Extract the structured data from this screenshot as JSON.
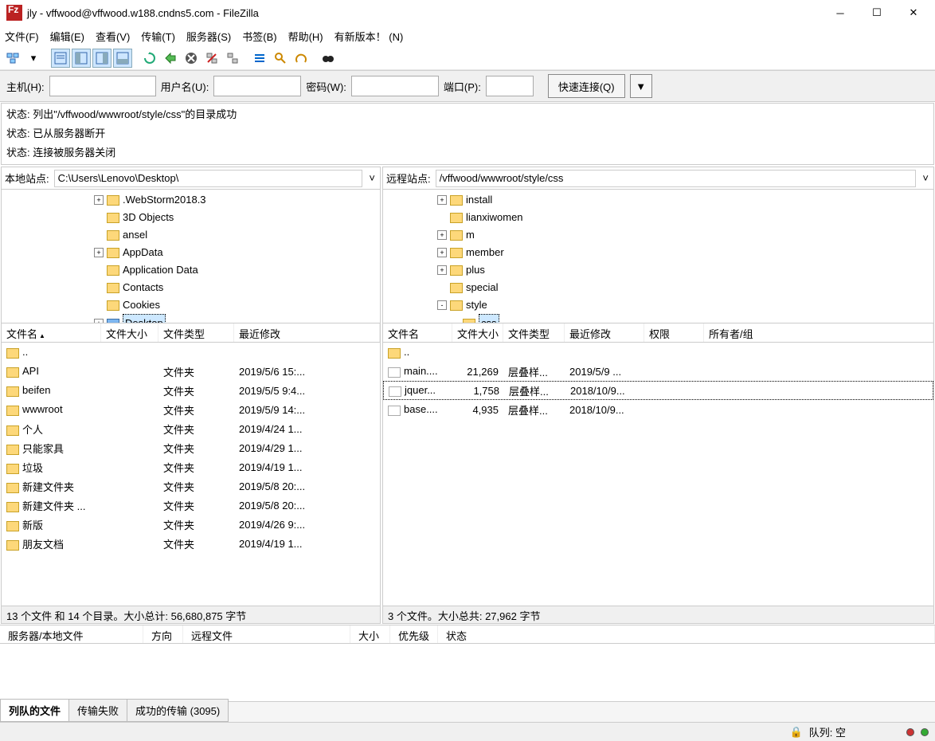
{
  "window": {
    "title": "jly - vffwood@vffwood.w188.cndns5.com - FileZilla"
  },
  "menu": {
    "file": "文件(F)",
    "edit": "编辑(E)",
    "view": "查看(V)",
    "transfer": "传输(T)",
    "server": "服务器(S)",
    "bookmark": "书签(B)",
    "help": "帮助(H)",
    "new_version": "有新版本！ (N)"
  },
  "quick": {
    "host_label": "主机(H):",
    "user_label": "用户名(U):",
    "pass_label": "密码(W):",
    "port_label": "端口(P):",
    "connect": "快速连接(Q)"
  },
  "log": {
    "lines": [
      {
        "k": "状态:",
        "v": "列出\"/vffwood/wwwroot/style/css\"的目录成功"
      },
      {
        "k": "状态:",
        "v": "已从服务器断开"
      },
      {
        "k": "状态:",
        "v": "连接被服务器关闭"
      }
    ]
  },
  "local": {
    "label": "本地站点:",
    "path": "C:\\Users\\Lenovo\\Desktop\\",
    "tree": [
      {
        "indent": 7,
        "exp": "+",
        "label": ".WebStorm2018.3"
      },
      {
        "indent": 7,
        "exp": "",
        "label": "3D Objects"
      },
      {
        "indent": 7,
        "exp": "",
        "label": "ansel"
      },
      {
        "indent": 7,
        "exp": "+",
        "label": "AppData"
      },
      {
        "indent": 7,
        "exp": "",
        "label": "Application Data"
      },
      {
        "indent": 7,
        "exp": "",
        "label": "Contacts"
      },
      {
        "indent": 7,
        "exp": "",
        "label": "Cookies"
      },
      {
        "indent": 7,
        "exp": "+",
        "label": "Desktop",
        "sel": true,
        "blue": true
      }
    ],
    "cols": {
      "name": "文件名",
      "size": "文件大小",
      "type": "文件类型",
      "modified": "最近修改"
    },
    "files": [
      {
        "name": "..",
        "size": "",
        "type": "",
        "modified": "",
        "ico": "folder"
      },
      {
        "name": "API",
        "size": "",
        "type": "文件夹",
        "modified": "2019/5/6 15:...",
        "ico": "folder"
      },
      {
        "name": "beifen",
        "size": "",
        "type": "文件夹",
        "modified": "2019/5/5 9:4...",
        "ico": "folder"
      },
      {
        "name": "wwwroot",
        "size": "",
        "type": "文件夹",
        "modified": "2019/5/9 14:...",
        "ico": "folder"
      },
      {
        "name": "个人",
        "size": "",
        "type": "文件夹",
        "modified": "2019/4/24 1...",
        "ico": "folder"
      },
      {
        "name": "只能家具",
        "size": "",
        "type": "文件夹",
        "modified": "2019/4/29 1...",
        "ico": "folder"
      },
      {
        "name": "垃圾",
        "size": "",
        "type": "文件夹",
        "modified": "2019/4/19 1...",
        "ico": "folder"
      },
      {
        "name": "新建文件夹",
        "size": "",
        "type": "文件夹",
        "modified": "2019/5/8 20:...",
        "ico": "folder"
      },
      {
        "name": "新建文件夹 ...",
        "size": "",
        "type": "文件夹",
        "modified": "2019/5/8 20:...",
        "ico": "folder"
      },
      {
        "name": "新版",
        "size": "",
        "type": "文件夹",
        "modified": "2019/4/26 9:...",
        "ico": "folder"
      },
      {
        "name": "朋友文档",
        "size": "",
        "type": "文件夹",
        "modified": "2019/4/19 1...",
        "ico": "folder"
      }
    ],
    "status": "13 个文件 和 14 个目录。大小总计: 56,680,875 字节"
  },
  "remote": {
    "label": "远程站点:",
    "path": "/vffwood/wwwroot/style/css",
    "tree": [
      {
        "indent": 4,
        "exp": "+",
        "label": "install"
      },
      {
        "indent": 4,
        "exp": "",
        "label": "lianxiwomen"
      },
      {
        "indent": 4,
        "exp": "+",
        "label": "m"
      },
      {
        "indent": 4,
        "exp": "+",
        "label": "member"
      },
      {
        "indent": 4,
        "exp": "+",
        "label": "plus"
      },
      {
        "indent": 4,
        "exp": "",
        "label": "special"
      },
      {
        "indent": 4,
        "exp": "-",
        "label": "style"
      },
      {
        "indent": 5,
        "exp": "",
        "label": "css",
        "sel": true
      }
    ],
    "cols": {
      "name": "文件名",
      "size": "文件大小",
      "type": "文件类型",
      "modified": "最近修改",
      "perm": "权限",
      "owner": "所有者/组"
    },
    "files": [
      {
        "name": "..",
        "size": "",
        "type": "",
        "modified": "",
        "ico": "folder"
      },
      {
        "name": "main....",
        "size": "21,269",
        "type": "层叠样...",
        "modified": "2019/5/9 ...",
        "ico": "file"
      },
      {
        "name": "jquer...",
        "size": "1,758",
        "type": "层叠样...",
        "modified": "2018/10/9...",
        "ico": "file",
        "sel": true
      },
      {
        "name": "base....",
        "size": "4,935",
        "type": "层叠样...",
        "modified": "2018/10/9...",
        "ico": "file"
      }
    ],
    "status": "3 个文件。大小总共: 27,962 字节"
  },
  "queue": {
    "cols": {
      "serverfile": "服务器/本地文件",
      "dir": "方向",
      "remote": "远程文件",
      "size": "大小",
      "priority": "优先级",
      "status": "状态"
    }
  },
  "tabs": {
    "queued": "列队的文件",
    "failed": "传输失败",
    "success": "成功的传输 (3095)"
  },
  "bottom": {
    "queue_label": "队列: 空"
  }
}
